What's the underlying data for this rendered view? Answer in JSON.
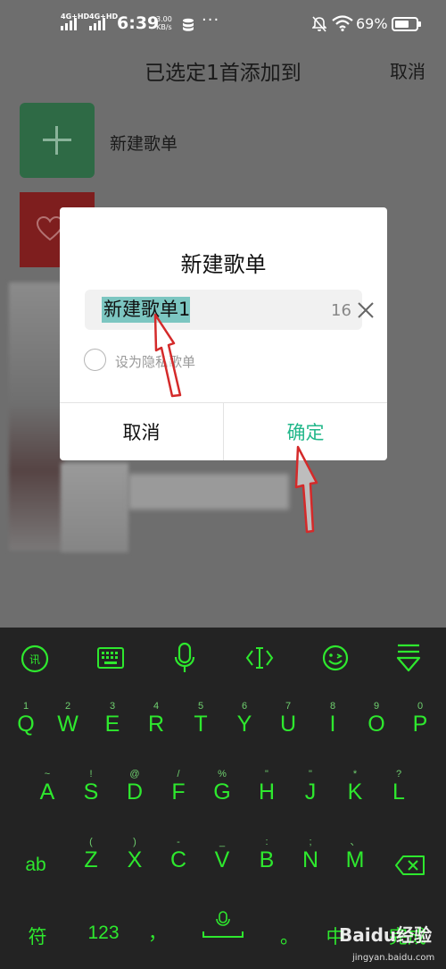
{
  "status_bar": {
    "sim1": "4G+HD",
    "sim2": "4G+HD",
    "time": "6:39",
    "net_speed_value": "3.00",
    "net_speed_unit": "KB/s",
    "more": "···",
    "battery_text": "69%",
    "battery_level": 0.69
  },
  "header": {
    "title": "已选定1首添加到",
    "cancel_label": "取消"
  },
  "background_list": {
    "new_playlist_label": "新建歌单"
  },
  "dialog": {
    "title": "新建歌单",
    "name_value": "新建歌单1",
    "char_counter": "16",
    "private_label": "设为隐私歌单",
    "cancel_label": "取消",
    "confirm_label": "确定"
  },
  "keyboard": {
    "toolbar_icons": [
      "voice-input-logo-icon",
      "keyboard-icon",
      "microphone-icon",
      "cursor-icon",
      "emoji-icon",
      "hide-keyboard-icon"
    ],
    "row1": [
      {
        "hint": "1",
        "key": "Q"
      },
      {
        "hint": "2",
        "key": "W"
      },
      {
        "hint": "3",
        "key": "E"
      },
      {
        "hint": "4",
        "key": "R"
      },
      {
        "hint": "5",
        "key": "T"
      },
      {
        "hint": "6",
        "key": "Y"
      },
      {
        "hint": "7",
        "key": "U"
      },
      {
        "hint": "8",
        "key": "I"
      },
      {
        "hint": "9",
        "key": "O"
      },
      {
        "hint": "0",
        "key": "P"
      }
    ],
    "row2": [
      {
        "hint": "~",
        "key": "A"
      },
      {
        "hint": "!",
        "key": "S"
      },
      {
        "hint": "@",
        "key": "D"
      },
      {
        "hint": "/",
        "key": "F"
      },
      {
        "hint": "%",
        "key": "G"
      },
      {
        "hint": "\"",
        "key": "H"
      },
      {
        "hint": "\"",
        "key": "J"
      },
      {
        "hint": "*",
        "key": "K"
      },
      {
        "hint": "?",
        "key": "L"
      }
    ],
    "row3": [
      {
        "hint": "(",
        "key": "Z"
      },
      {
        "hint": ")",
        "key": "X"
      },
      {
        "hint": "-",
        "key": "C"
      },
      {
        "hint": "_",
        "key": "V"
      },
      {
        "hint": ":",
        "key": "B"
      },
      {
        "hint": ";",
        "key": "N"
      },
      {
        "hint": "、",
        "key": "M"
      }
    ],
    "ab_label": "ab",
    "fu_label": "符",
    "num_label": "123",
    "comma_label": "，",
    "period_label": "。",
    "cn_label": "中",
    "done_label": "完成"
  },
  "watermark": {
    "brand": "Baidu经验",
    "url": "jingyan.baidu.com"
  },
  "colors": {
    "accent_green": "#22b78a",
    "keyboard_text": "#2ee82e",
    "keyboard_bg": "#232323",
    "selection_highlight": "#7cc6c1",
    "annotation_arrow": "#d42a2a"
  }
}
